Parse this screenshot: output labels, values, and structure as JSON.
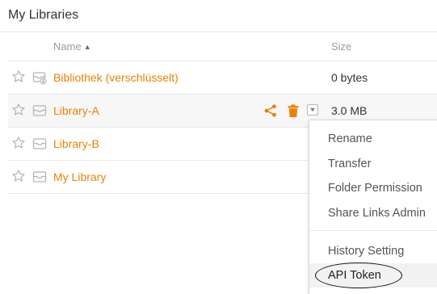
{
  "page": {
    "title": "My Libraries"
  },
  "table": {
    "headers": {
      "name": "Name",
      "size": "Size"
    },
    "sort_indicator": "▲",
    "rows": [
      {
        "name": "Bibliothek (verschlüsselt)",
        "size": "0 bytes",
        "icon": "encrypted-library-icon",
        "starred": false
      },
      {
        "name": "Library-A",
        "size": "3.0 MB",
        "icon": "library-icon",
        "starred": false
      },
      {
        "name": "Library-B",
        "size": "",
        "icon": "library-icon",
        "starred": false
      },
      {
        "name": "My Library",
        "size": "",
        "icon": "library-icon",
        "starred": false
      }
    ]
  },
  "operations": {
    "share_icon": "share-icon",
    "delete_icon": "trash-icon",
    "more_icon": "dropdown-caret-icon"
  },
  "dropdown_menu": {
    "items": [
      "Rename",
      "Transfer",
      "Folder Permission",
      "Share Links Admin",
      "History Setting",
      "API Token"
    ],
    "active_item": "API Token"
  },
  "colors": {
    "link": "#eb8205",
    "text": "#333333",
    "muted": "#9c9c9c",
    "border": "#e8e8e8",
    "hover_row": "#f7f7f7"
  }
}
